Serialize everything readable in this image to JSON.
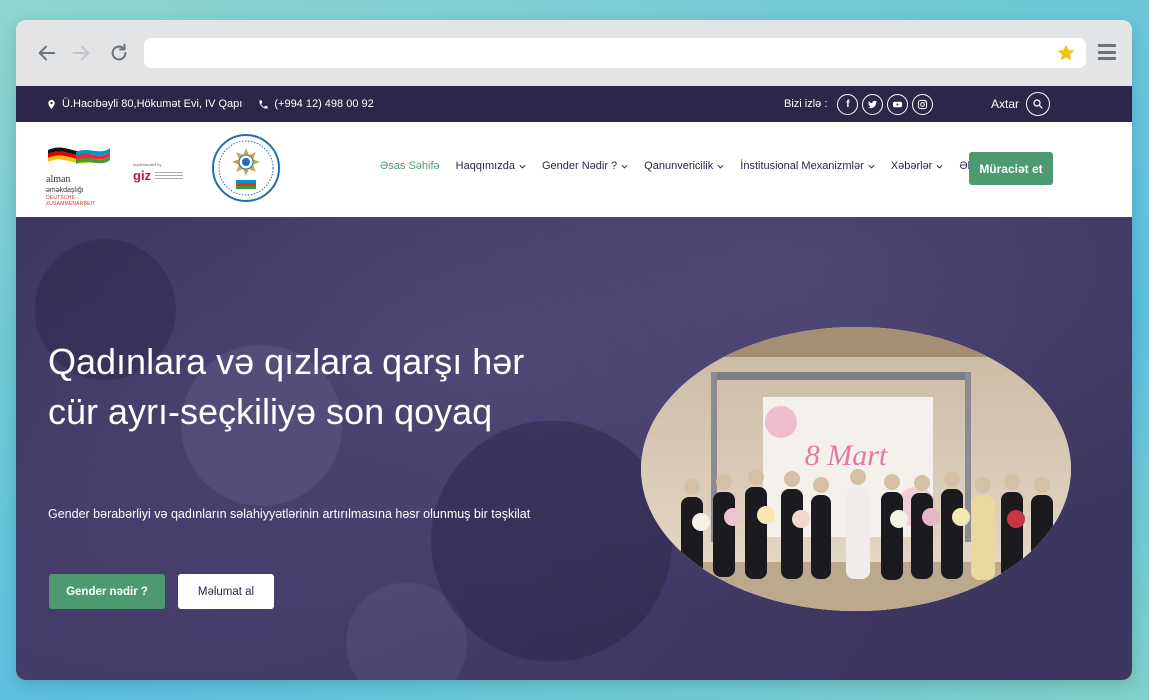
{
  "browser": {
    "back_icon": "arrow-left-icon",
    "forward_icon": "arrow-right-icon",
    "reload_icon": "reload-icon",
    "address_value": "",
    "bookmark_icon": "star-icon",
    "menu_icon": "hamburger-icon",
    "colors": {
      "chrome": "#e3e4e6",
      "star": "#f4c20d"
    }
  },
  "topbar": {
    "address": "Ü.Hacıbəyli 80,Hökumət Evi, IV Qapı",
    "phone": "(+994 12) 498 00 92",
    "follow_label": "Bizi izlə :",
    "social_icons": [
      "facebook-icon",
      "twitter-icon",
      "youtube-icon",
      "instagram-icon"
    ],
    "search_label": "Axtar",
    "colors": {
      "background": "#2c2648"
    }
  },
  "header": {
    "logo_alman_name": "alman",
    "logo_alman_line2": "əməkdaşlığı",
    "logo_alman_sub": "DEUTSCHE ZUSAMMENARBEIT",
    "logo_giz_small": "Implemented by",
    "logo_giz": "giz",
    "nav": [
      {
        "label": "Əsas Səhifə",
        "dropdown": false,
        "active": true
      },
      {
        "label": "Haqqımızda",
        "dropdown": true,
        "active": false
      },
      {
        "label": "Gender Nədir ?",
        "dropdown": true,
        "active": false
      },
      {
        "label": "Qanunvericilik",
        "dropdown": true,
        "active": false
      },
      {
        "label": "İnstitusional Mexanizmlər",
        "dropdown": true,
        "active": false
      },
      {
        "label": "Xəbərlər",
        "dropdown": true,
        "active": false
      },
      {
        "label": "Əlaqə",
        "dropdown": false,
        "active": false
      }
    ],
    "cta_label": "Müraciət et",
    "colors": {
      "accent": "#4c9a6e",
      "text": "#2c2648"
    }
  },
  "hero": {
    "title": "Qadınlara və qızlara qarşı hər cür ayrı-seçkiliyə son qoyaq",
    "subtitle": "Gender bərabərliyi və qadınların səlahiyyətlərinin artırılmasına həsr olunmuş bir təşkilat",
    "primary_button": "Gender nədir ?",
    "secondary_button": "Məlumat al",
    "photo_banner_text": "8 Mart",
    "colors": {
      "overlay": "#3d3660"
    }
  }
}
